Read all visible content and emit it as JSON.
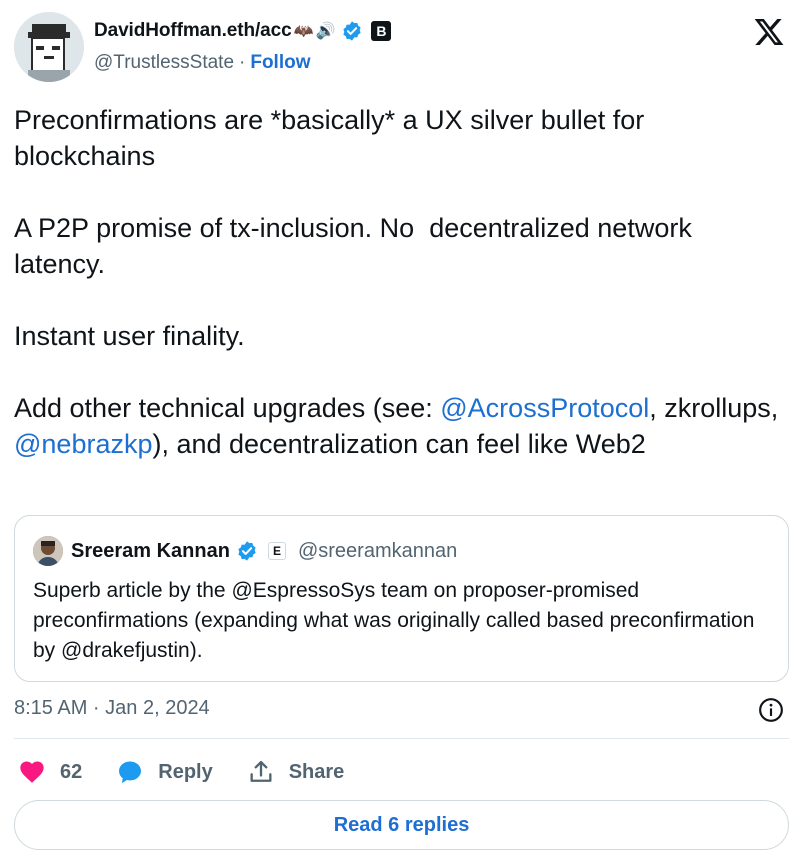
{
  "author": {
    "display_name": "DavidHoffman.eth/acc",
    "emoji_1": "🦇",
    "emoji_2": "🔊",
    "handle": "@TrustlessState",
    "separator": "·",
    "follow_label": "Follow",
    "badge_letter": "B"
  },
  "tweet": {
    "p1": "Preconfirmations are *basically* a UX silver bullet for blockchains",
    "p2": "A P2P promise of tx-inclusion. No  decentralized network latency.",
    "p3": "Instant user finality.",
    "p4_a": "Add other technical upgrades (see: ",
    "p4_mention_1": "@AcrossProtocol",
    "p4_b": ", zkrollups, ",
    "p4_mention_2": "@nebrazkp",
    "p4_c": "), and decentralization can feel like Web2"
  },
  "quote": {
    "name": "Sreeram Kannan",
    "badge_letter": "E",
    "handle": "@sreeramkannan",
    "text": "Superb article by the @EspressoSys team on proposer-promised preconfirmations (expanding what was originally called based preconfirmation by @drakefjustin)."
  },
  "timestamp": "8:15 AM · Jan 2, 2024",
  "actions": {
    "likes_count": "62",
    "reply_label": "Reply",
    "share_label": "Share"
  },
  "read_replies_label": "Read 6 replies",
  "colors": {
    "accent": "#1d6fd1",
    "like": "#f91880",
    "verified": "#1d9bf0",
    "muted": "#536471"
  }
}
